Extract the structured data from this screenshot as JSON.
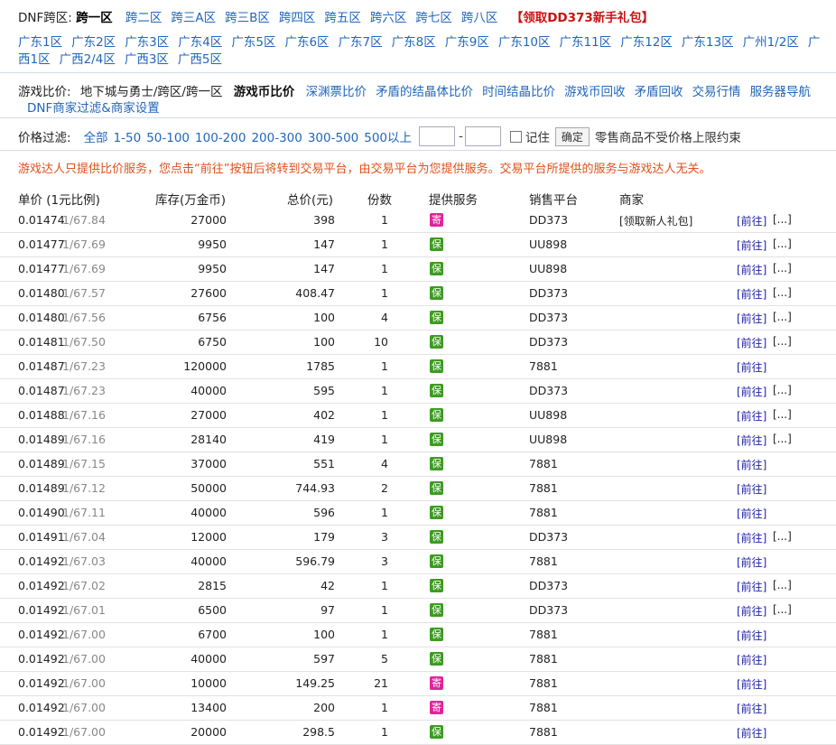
{
  "crossbar": {
    "label": "DNF跨区:",
    "current": "跨一区",
    "links": [
      "跨二区",
      "跨三A区",
      "跨三B区",
      "跨四区",
      "跨五区",
      "跨六区",
      "跨七区",
      "跨八区"
    ],
    "promo": "【领取DD373新手礼包】"
  },
  "servers": [
    "广东1区",
    "广东2区",
    "广东3区",
    "广东4区",
    "广东5区",
    "广东6区",
    "广东7区",
    "广东8区",
    "广东9区",
    "广东10区",
    "广东11区",
    "广东12区",
    "广东13区",
    "广州1/2区",
    "广西1区",
    "广西2/4区",
    "广西3区",
    "广西5区"
  ],
  "games": {
    "label": "游戏比价:",
    "item": "地下城与勇士/跨区/跨一区",
    "current": "游戏币比价",
    "links": [
      "深渊票比价",
      "矛盾的结晶体比价",
      "时间结晶比价",
      "游戏币回收",
      "矛盾回收",
      "交易行情",
      "服务器导航"
    ],
    "merchant_settings": "DNF商家过滤&商家设置"
  },
  "price_filter": {
    "label": "价格过滤:",
    "options": [
      "全部",
      "1-50",
      "50-100",
      "100-200",
      "200-300",
      "300-500",
      "500以上"
    ],
    "min_value": "",
    "max_value": "",
    "remember_label": "记住",
    "confirm_label": "确定",
    "note": "零售商品不受价格上限约束"
  },
  "notice": "游戏达人只提供比价服务，您点击“前往”按钮后将转到交易平台，由交易平台为您提供服务。交易平台所提供的服务与游戏达人无关。",
  "columns": [
    "单价 (1元比例)",
    "库存(万金币)",
    "总价(元)",
    "份数",
    "提供服务",
    "销售平台",
    "商家"
  ],
  "go_label": "[前往]",
  "more_label": "[...]",
  "badge_labels": {
    "bao": "保",
    "ji": "寄"
  },
  "rows": [
    {
      "unit": "0.01474",
      "ratio": "1/67.84",
      "stock": "27000",
      "total": "398",
      "qty": "1",
      "badge": "ji",
      "platform": "DD373",
      "merchant": "[领取新人礼包]",
      "more": true
    },
    {
      "unit": "0.01477",
      "ratio": "1/67.69",
      "stock": "9950",
      "total": "147",
      "qty": "1",
      "badge": "bao",
      "platform": "UU898",
      "merchant": "",
      "more": true
    },
    {
      "unit": "0.01477",
      "ratio": "1/67.69",
      "stock": "9950",
      "total": "147",
      "qty": "1",
      "badge": "bao",
      "platform": "UU898",
      "merchant": "",
      "more": true
    },
    {
      "unit": "0.01480",
      "ratio": "1/67.57",
      "stock": "27600",
      "total": "408.47",
      "qty": "1",
      "badge": "bao",
      "platform": "DD373",
      "merchant": "",
      "more": true
    },
    {
      "unit": "0.01480",
      "ratio": "1/67.56",
      "stock": "6756",
      "total": "100",
      "qty": "4",
      "badge": "bao",
      "platform": "DD373",
      "merchant": "",
      "more": true
    },
    {
      "unit": "0.01481",
      "ratio": "1/67.50",
      "stock": "6750",
      "total": "100",
      "qty": "10",
      "badge": "bao",
      "platform": "DD373",
      "merchant": "",
      "more": true
    },
    {
      "unit": "0.01487",
      "ratio": "1/67.23",
      "stock": "120000",
      "total": "1785",
      "qty": "1",
      "badge": "bao",
      "platform": "7881",
      "merchant": "",
      "more": false
    },
    {
      "unit": "0.01487",
      "ratio": "1/67.23",
      "stock": "40000",
      "total": "595",
      "qty": "1",
      "badge": "bao",
      "platform": "DD373",
      "merchant": "",
      "more": true
    },
    {
      "unit": "0.01488",
      "ratio": "1/67.16",
      "stock": "27000",
      "total": "402",
      "qty": "1",
      "badge": "bao",
      "platform": "UU898",
      "merchant": "",
      "more": true
    },
    {
      "unit": "0.01489",
      "ratio": "1/67.16",
      "stock": "28140",
      "total": "419",
      "qty": "1",
      "badge": "bao",
      "platform": "UU898",
      "merchant": "",
      "more": true
    },
    {
      "unit": "0.01489",
      "ratio": "1/67.15",
      "stock": "37000",
      "total": "551",
      "qty": "4",
      "badge": "bao",
      "platform": "7881",
      "merchant": "",
      "more": false
    },
    {
      "unit": "0.01489",
      "ratio": "1/67.12",
      "stock": "50000",
      "total": "744.93",
      "qty": "2",
      "badge": "bao",
      "platform": "7881",
      "merchant": "",
      "more": false
    },
    {
      "unit": "0.01490",
      "ratio": "1/67.11",
      "stock": "40000",
      "total": "596",
      "qty": "1",
      "badge": "bao",
      "platform": "7881",
      "merchant": "",
      "more": false
    },
    {
      "unit": "0.01491",
      "ratio": "1/67.04",
      "stock": "12000",
      "total": "179",
      "qty": "3",
      "badge": "bao",
      "platform": "DD373",
      "merchant": "",
      "more": true
    },
    {
      "unit": "0.01492",
      "ratio": "1/67.03",
      "stock": "40000",
      "total": "596.79",
      "qty": "3",
      "badge": "bao",
      "platform": "7881",
      "merchant": "",
      "more": false
    },
    {
      "unit": "0.01492",
      "ratio": "1/67.02",
      "stock": "2815",
      "total": "42",
      "qty": "1",
      "badge": "bao",
      "platform": "DD373",
      "merchant": "",
      "more": true
    },
    {
      "unit": "0.01492",
      "ratio": "1/67.01",
      "stock": "6500",
      "total": "97",
      "qty": "1",
      "badge": "bao",
      "platform": "DD373",
      "merchant": "",
      "more": true
    },
    {
      "unit": "0.01492",
      "ratio": "1/67.00",
      "stock": "6700",
      "total": "100",
      "qty": "1",
      "badge": "bao",
      "platform": "7881",
      "merchant": "",
      "more": false
    },
    {
      "unit": "0.01492",
      "ratio": "1/67.00",
      "stock": "40000",
      "total": "597",
      "qty": "5",
      "badge": "bao",
      "platform": "7881",
      "merchant": "",
      "more": false
    },
    {
      "unit": "0.01492",
      "ratio": "1/67.00",
      "stock": "10000",
      "total": "149.25",
      "qty": "21",
      "badge": "ji",
      "platform": "7881",
      "merchant": "",
      "more": false
    },
    {
      "unit": "0.01492",
      "ratio": "1/67.00",
      "stock": "13400",
      "total": "200",
      "qty": "1",
      "badge": "ji",
      "platform": "7881",
      "merchant": "",
      "more": false
    },
    {
      "unit": "0.01492",
      "ratio": "1/67.00",
      "stock": "20000",
      "total": "298.5",
      "qty": "1",
      "badge": "bao",
      "platform": "7881",
      "merchant": "",
      "more": false
    }
  ]
}
